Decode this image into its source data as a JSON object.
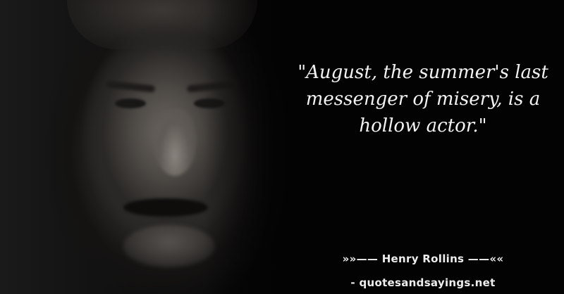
{
  "quote": {
    "text": "\"August, the summer's last messenger of misery, is a hollow actor.\"",
    "author_line": "»»—— Henry Rollins ——««",
    "source": "- quotesandsayings.net"
  },
  "portrait": {
    "description_icon": "portrait-photo"
  },
  "colors": {
    "background": "#030303",
    "text": "#f2f2f2"
  }
}
